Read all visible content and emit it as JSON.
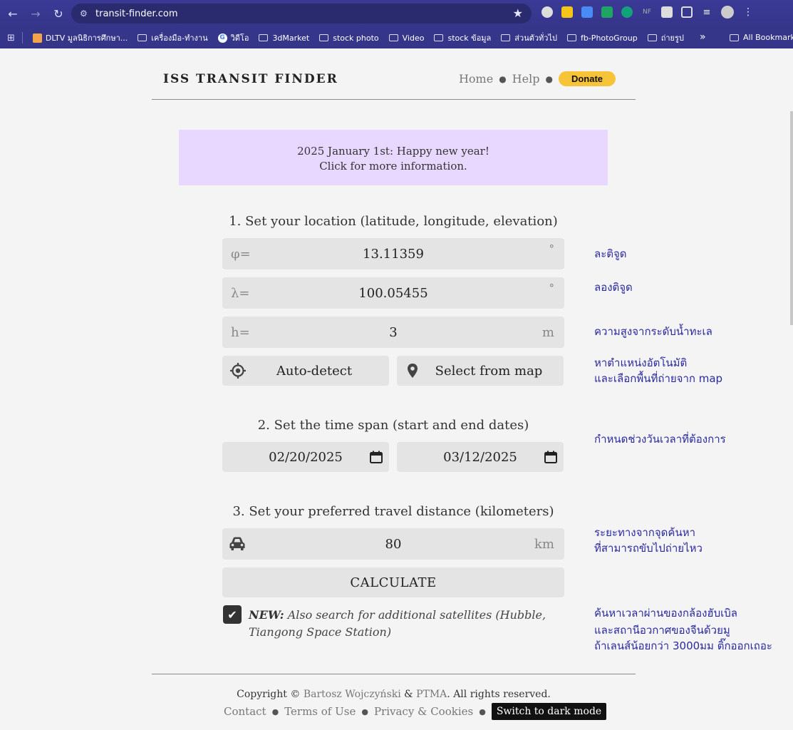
{
  "browser": {
    "url": "transit-finder.com",
    "bookmarks": [
      "DLTV มูลนิธิการศึกษา...",
      "เครื่องมือ-ทำงาน",
      "วิดีโอ",
      "3dMarket",
      "stock photo",
      "Video",
      "stock ข้อมูล",
      "ส่วนตัวทั่วไป",
      "fb-PhotoGroup",
      "ถ่ายรูป"
    ],
    "all_bookmarks": "All Bookmarks",
    "more": "»",
    "extensions": [
      "NF"
    ]
  },
  "header": {
    "title": "ISS TRANSIT FINDER",
    "nav_home": "Home",
    "nav_help": "Help",
    "donate": "Donate"
  },
  "announcement": {
    "line1": "2025 January 1st: Happy new year!",
    "line2": "Click for more information."
  },
  "location": {
    "title": "1. Set your location (latitude, longitude, elevation)",
    "lat_prefix": "φ=",
    "lat_value": "13.11359",
    "lat_unit": "°",
    "lon_prefix": "λ=",
    "lon_value": "100.05455",
    "lon_unit": "°",
    "elev_prefix": "h=",
    "elev_value": "3",
    "elev_unit": "m",
    "auto_detect": "Auto-detect",
    "select_map": "Select from map"
  },
  "time_span": {
    "title": "2. Set the time span (start and end dates)",
    "start": "02/20/2025",
    "end": "03/12/2025"
  },
  "distance": {
    "title": "3. Set your preferred travel distance (kilometers)",
    "value": "80",
    "unit": "km"
  },
  "calculate": "CALCULATE",
  "additional_sats": {
    "new_label": "NEW:",
    "text": "Also search for additional satellites (Hubble, Tiangong Space Station)",
    "checked": true
  },
  "footer": {
    "copyright_prefix": "Copyright ©",
    "author": "Bartosz Wojczyński",
    "amp": "&",
    "org": "PTMA",
    "rights": ". All rights reserved.",
    "contact": "Contact",
    "terms": "Terms of Use",
    "privacy": "Privacy & Cookies",
    "dark_mode": "Switch to dark mode"
  },
  "annotations": {
    "latitude": "ละติจูด",
    "longitude": "ลองติจูด",
    "elevation": "ความสูงจากระดับน้ำทะเล",
    "location_1": "หาตำแหน่งอัตโนมัติ",
    "location_2": "และเลือกพื้นที่ถ่ายจาก map",
    "time": "กำหนดช่วงวันเวลาที่ต้องการ",
    "distance_1": "ระยะทางจากจุดค้นหา",
    "distance_2": "ที่สามารถขับไปถ่ายไหว",
    "sats_1": "ค้นหาเวลาผ่านของกล้องฮับเบิล",
    "sats_2": "และสถานีอวกาศของจีนด้วยมู",
    "sats_3": "ถ้าเลนส์น้อยกว่า 3000มม ติ๊กออกเถอะ"
  },
  "colors": {
    "browser_bar": "#35358a",
    "announcement_bg": "#e8d8ff",
    "donate": "#f7c439",
    "annotation_text": "#2a2a9e"
  }
}
